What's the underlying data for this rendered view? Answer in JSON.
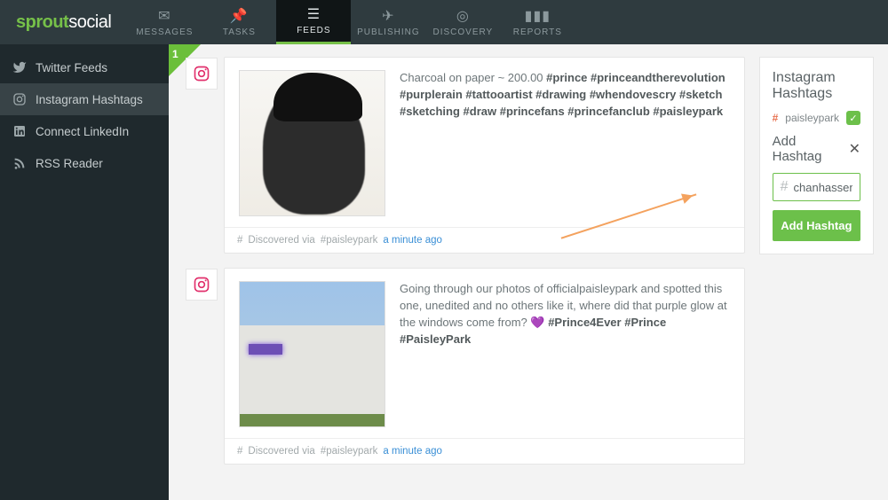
{
  "brand": {
    "part1": "sprout",
    "part2": "social"
  },
  "topnav": [
    {
      "label": "MESSAGES"
    },
    {
      "label": "TASKS"
    },
    {
      "label": "FEEDS"
    },
    {
      "label": "PUBLISHING"
    },
    {
      "label": "DISCOVERY"
    },
    {
      "label": "REPORTS"
    }
  ],
  "sidebar": [
    {
      "label": "Twitter Feeds"
    },
    {
      "label": "Instagram Hashtags"
    },
    {
      "label": "Connect LinkedIn"
    },
    {
      "label": "RSS Reader"
    }
  ],
  "badge": {
    "count": "1"
  },
  "posts": [
    {
      "caption_plain": "Charcoal on paper ~ 200.00 ",
      "caption_bold": "#prince #princeandtherevolution #purplerain #tattooartist #drawing #whendovescry #sketch #sketching #draw #princefans #princefanclub #paisleypark",
      "discovered_prefix": "Discovered via ",
      "discovered_tag": "#paisleypark",
      "discovered_time": "a minute ago"
    },
    {
      "caption_plain": "Going through our photos of officialpaisleypark and spotted this one, unedited and no others like it, where did that purple glow at the windows come from? 💜 ",
      "caption_bold": "#Prince4Ever #Prince #PaisleyPark",
      "discovered_prefix": "Discovered via ",
      "discovered_tag": "#paisleypark",
      "discovered_time": "a minute ago"
    }
  ],
  "panel": {
    "title": "Instagram Hashtags",
    "existing_tag": "paisleypark",
    "add_label": "Add Hashtag",
    "input_value": "chanhassen",
    "button_label": "Add Hashtag",
    "hash_symbol": "#",
    "close_symbol": "✕",
    "check_symbol": "✓"
  }
}
